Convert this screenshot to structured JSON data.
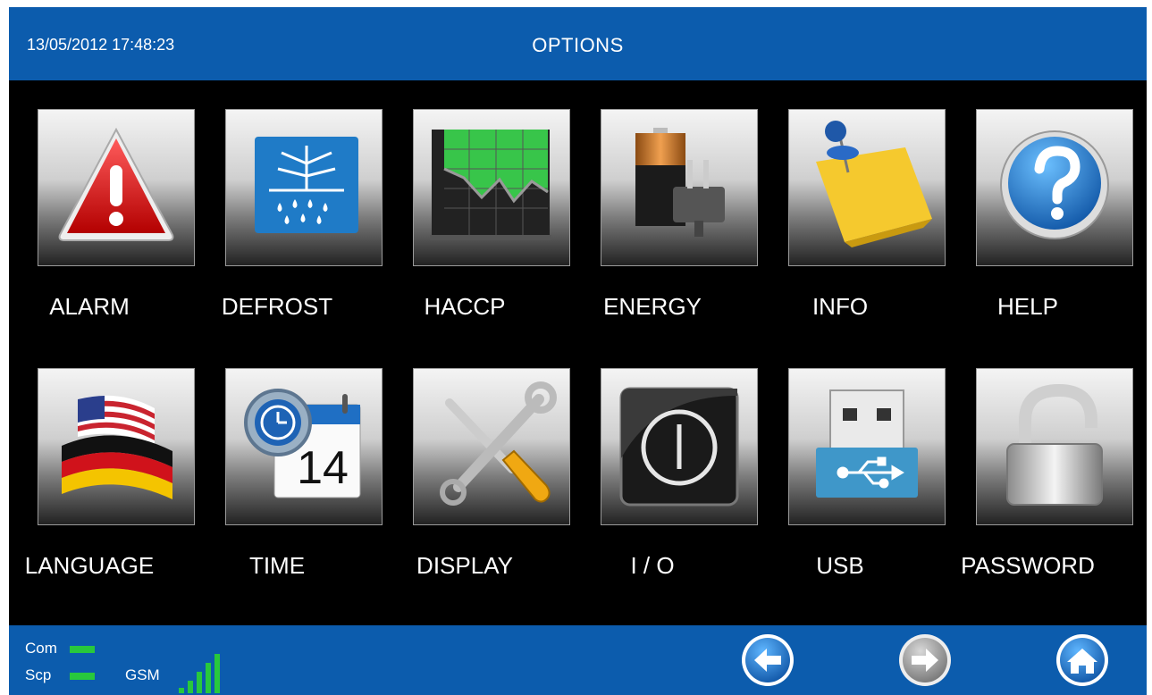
{
  "header": {
    "datetime": "13/05/2012 17:48:23",
    "title": "OPTIONS"
  },
  "tiles": [
    {
      "label": "ALARM",
      "icon": "alarm-warning-icon"
    },
    {
      "label": "DEFROST",
      "icon": "defrost-snowflake-icon"
    },
    {
      "label": "HACCP",
      "icon": "haccp-chart-icon"
    },
    {
      "label": "ENERGY",
      "icon": "energy-battery-plug-icon"
    },
    {
      "label": "INFO",
      "icon": "info-note-pin-icon"
    },
    {
      "label": "HELP",
      "icon": "help-question-icon"
    },
    {
      "label": "LANGUAGE",
      "icon": "language-flags-icon"
    },
    {
      "label": "TIME",
      "icon": "time-clock-calendar-icon"
    },
    {
      "label": "DISPLAY",
      "icon": "display-tools-icon"
    },
    {
      "label": "I / O",
      "icon": "io-power-icon"
    },
    {
      "label": "USB",
      "icon": "usb-icon"
    },
    {
      "label": "PASSWORD",
      "icon": "password-padlock-icon"
    }
  ],
  "calendar_day": "14",
  "status": {
    "com_label": "Com",
    "scp_label": "Scp",
    "gsm_label": "GSM"
  },
  "nav": {
    "back": "arrow-left-icon",
    "forward": "arrow-right-icon",
    "home": "home-icon"
  },
  "colors": {
    "bar": "#0c5cad",
    "led": "#28c83c"
  }
}
